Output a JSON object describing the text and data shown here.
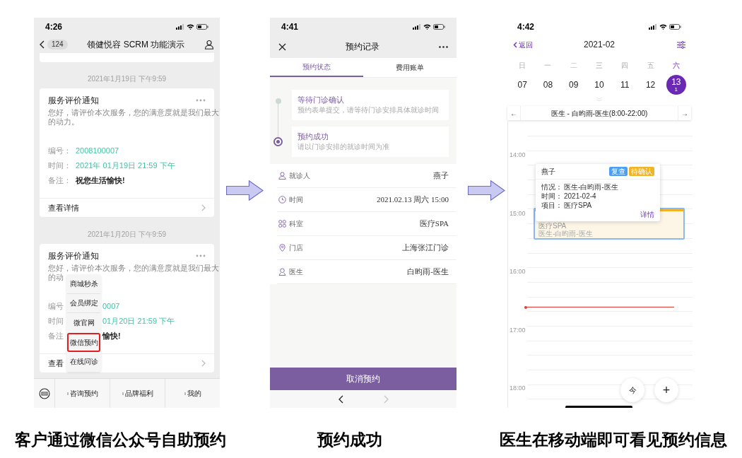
{
  "wechat_screen": {
    "status_time": "4:26",
    "nav": {
      "badge": "124",
      "title": "领健悦容 SCRM 功能演示"
    },
    "messages": [
      {
        "timestamp": "2021年1月19日 下午9:59",
        "title": "服务评价通知",
        "body_lines": [
          "您好，请评价本次服务，您的满意度就是我们最大",
          "的动力。"
        ],
        "fields": [
          {
            "label": "编号：",
            "value": "2008100007",
            "kind": "highlight"
          },
          {
            "label": "时间：",
            "value": "2021年 01月19日 21:59 下午",
            "kind": "highlight"
          },
          {
            "label": "备注：",
            "value": "祝您生活愉快!",
            "kind": "plain"
          }
        ],
        "footer": "查看详情",
        "covered_by_menu": false
      },
      {
        "timestamp": "2021年1月20日 下午9:59",
        "title": "服务评价通知",
        "body_lines": [
          "您好，请评价本次服务，您的满意度就是我们最大",
          "的动"
        ],
        "fields": [
          {
            "label": "编号",
            "value": "0007",
            "kind": "highlight"
          },
          {
            "label": "时间",
            "value": "01月20日 21:59 下午",
            "kind": "highlight"
          },
          {
            "label": "备注",
            "value": "愉快!",
            "kind": "plain"
          }
        ],
        "footer": "查看",
        "covered_by_menu": true
      }
    ],
    "menu": [
      {
        "label": "商城秒杀",
        "selected": false
      },
      {
        "label": "会员绑定",
        "selected": false
      },
      {
        "label": "微官网",
        "selected": false
      },
      {
        "label": "微信预约",
        "selected": true
      },
      {
        "label": "在线问诊",
        "selected": false
      }
    ],
    "bottom_menu": [
      "咨询预约",
      "品牌福利",
      "我的"
    ]
  },
  "booking_screen": {
    "status_time": "4:41",
    "title": "预约记录",
    "tabs": [
      {
        "label": "预约状态",
        "selected": true
      },
      {
        "label": "费用账单",
        "selected": false
      }
    ],
    "steps": [
      {
        "title": "等待门诊确认",
        "note": "预约表单提交，请等待门诊安排具体就诊时间",
        "current": false
      },
      {
        "title": "预约成功",
        "note": "请以门诊安排的就诊时间为准",
        "current": true
      }
    ],
    "details": [
      {
        "kind": "person",
        "label": "就诊人",
        "value": "燕子"
      },
      {
        "kind": "clock",
        "label": "时间",
        "value": "2021.02.13 周六 15:00"
      },
      {
        "kind": "grid",
        "label": "科室",
        "value": "医疗SPA"
      },
      {
        "kind": "pin",
        "label": "门店",
        "value": "上海张江门诊"
      },
      {
        "kind": "doctor",
        "label": "医生",
        "value": "白昀雨-医生"
      }
    ],
    "action": "取消预约",
    "nav_buttons": [
      {
        "kind": "back",
        "disabled": false
      },
      {
        "kind": "forward",
        "disabled": true
      }
    ]
  },
  "calendar_screen": {
    "status_time": "4:42",
    "back": "返回",
    "month": "2021-02",
    "days": [
      {
        "weekday": "日",
        "date": "07",
        "selected": false
      },
      {
        "weekday": "一",
        "date": "08",
        "selected": false
      },
      {
        "weekday": "二",
        "date": "09",
        "selected": false
      },
      {
        "weekday": "三",
        "date": "10",
        "selected": false
      },
      {
        "weekday": "四",
        "date": "11",
        "selected": false
      },
      {
        "weekday": "五",
        "date": "12",
        "selected": false
      },
      {
        "weekday": "六",
        "date": "13",
        "count": "1",
        "selected": true
      }
    ],
    "doctor_bar": {
      "prev": "←",
      "label": "医生 - 白昀雨-医生(8:00-22:00)",
      "next": "→"
    },
    "hours": [
      "14:00",
      "15:00",
      "16:00",
      "17:00",
      "18:00"
    ],
    "event": {
      "title": "医疗SPA",
      "subtitle": "医生-白昀雨-医生"
    },
    "popup": {
      "name": "燕子",
      "tags": [
        {
          "label": "复查",
          "color": "#4a9ff5"
        },
        {
          "label": "待确认",
          "color": "#f0b429"
        }
      ],
      "lines": [
        {
          "label": "情况：",
          "value": "医生-白昀雨-医生"
        },
        {
          "label": "时间：",
          "value": "2021-02-4"
        },
        {
          "label": "项目：",
          "value": "医疗SPA"
        }
      ],
      "link": "详情"
    },
    "fab": [
      {
        "kind": "today",
        "label": "今"
      },
      {
        "kind": "add",
        "label": "+"
      }
    ]
  },
  "captions": [
    "客户通过微信公众号自助预约",
    "预约成功",
    "医生在移动端即可看见预约信息"
  ]
}
